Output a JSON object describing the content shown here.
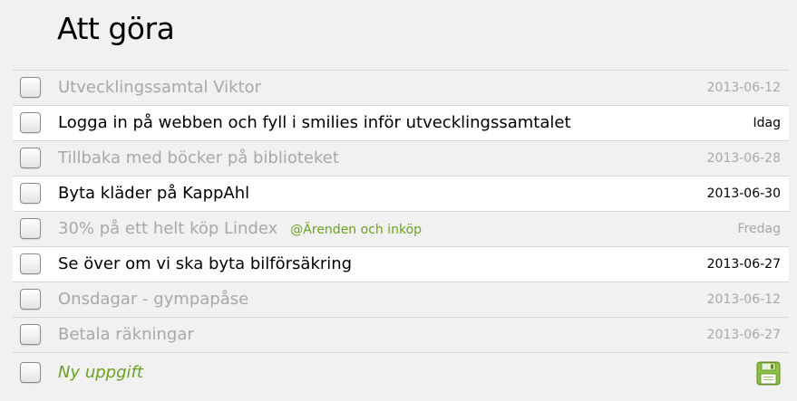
{
  "page": {
    "title": "Att göra"
  },
  "tasks": [
    {
      "label": "Utvecklingssamtal Viktor",
      "tag": "",
      "date": "2013-06-12",
      "active": false
    },
    {
      "label": "Logga in på webben och fyll i smilies inför utvecklingssamtalet",
      "tag": "",
      "date": "Idag",
      "active": true
    },
    {
      "label": "Tillbaka med böcker på biblioteket",
      "tag": "",
      "date": "2013-06-28",
      "active": false
    },
    {
      "label": "Byta kläder på KappAhl",
      "tag": "",
      "date": "2013-06-30",
      "active": true
    },
    {
      "label": "30% på ett helt köp Lindex",
      "tag": "@Ärenden och inköp",
      "date": "Fredag",
      "active": false
    },
    {
      "label": "Se över om vi ska byta bilförsäkring",
      "tag": "",
      "date": "2013-06-27",
      "active": true
    },
    {
      "label": "Onsdagar - gympapåse",
      "tag": "",
      "date": "2013-06-12",
      "active": false
    },
    {
      "label": "Betala räkningar",
      "tag": "",
      "date": "2013-06-27",
      "active": false
    }
  ],
  "new_task": {
    "placeholder": "Ny uppgift",
    "save_icon": "floppy-disk-icon"
  },
  "colors": {
    "background": "#f1f1f1",
    "active_row": "#ffffff",
    "muted_text": "#a8a8a8",
    "accent_green": "#6aa21f",
    "divider": "#d6d6d6"
  }
}
